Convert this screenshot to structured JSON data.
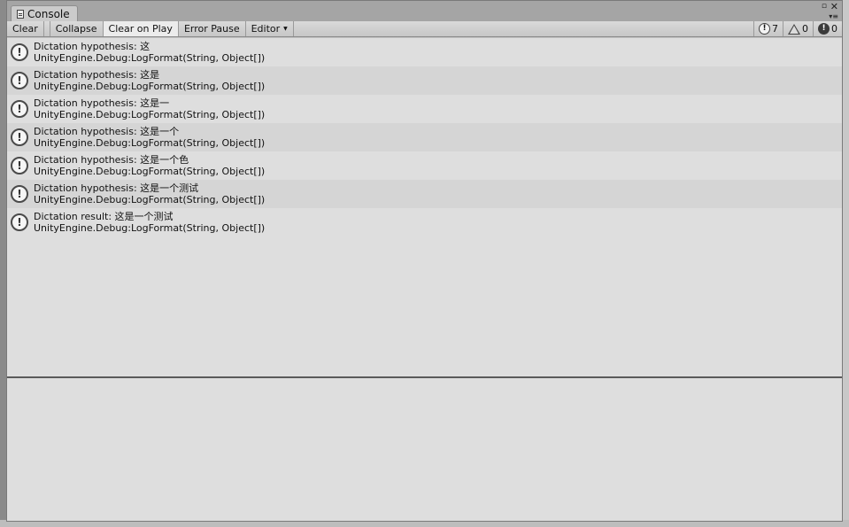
{
  "window": {
    "tab_title": "Console",
    "tab_icon": "console-doc-icon",
    "maximize_glyph": "▫",
    "close_glyph": "✕",
    "menu_glyph": "▾≡"
  },
  "toolbar": {
    "clear": "Clear",
    "collapse": "Collapse",
    "clear_on_play": "Clear on Play",
    "error_pause": "Error Pause",
    "editor": "Editor",
    "editor_caret": "▼"
  },
  "counters": {
    "info_icon": "!",
    "info_count": "7",
    "warning_count": "0",
    "error_icon": "!",
    "error_count": "0"
  },
  "log_entries": [
    {
      "icon": "!",
      "message": "Dictation hypothesis: 这",
      "stack": "UnityEngine.Debug:LogFormat(String, Object[])"
    },
    {
      "icon": "!",
      "message": "Dictation hypothesis: 这是",
      "stack": "UnityEngine.Debug:LogFormat(String, Object[])"
    },
    {
      "icon": "!",
      "message": "Dictation hypothesis: 这是一",
      "stack": "UnityEngine.Debug:LogFormat(String, Object[])"
    },
    {
      "icon": "!",
      "message": "Dictation hypothesis: 这是一个",
      "stack": "UnityEngine.Debug:LogFormat(String, Object[])"
    },
    {
      "icon": "!",
      "message": "Dictation hypothesis: 这是一个色",
      "stack": "UnityEngine.Debug:LogFormat(String, Object[])"
    },
    {
      "icon": "!",
      "message": "Dictation hypothesis: 这是一个测试",
      "stack": "UnityEngine.Debug:LogFormat(String, Object[])"
    },
    {
      "icon": "!",
      "message": "Dictation result: 这是一个测试",
      "stack": "UnityEngine.Debug:LogFormat(String, Object[])"
    }
  ]
}
